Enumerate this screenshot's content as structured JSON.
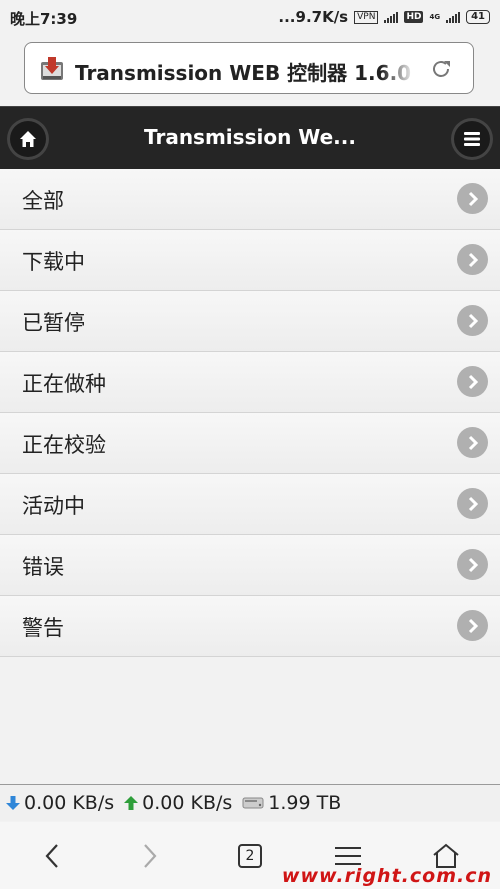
{
  "status_bar": {
    "time": "晚上7:39",
    "speed": "...9.7K/s",
    "vpn": "VPN",
    "hd": "HD",
    "net": "4G",
    "battery": "41"
  },
  "url_bar": {
    "title": "Transmission WEB 控制器 1.6.0",
    "favicon": "transmission-logo-icon",
    "reload_icon": "reload-icon"
  },
  "header": {
    "title": "Transmission We...",
    "home_icon": "home-icon",
    "menu_icon": "menu-icon"
  },
  "filters": [
    {
      "label": "全部"
    },
    {
      "label": "下载中"
    },
    {
      "label": "已暂停"
    },
    {
      "label": "正在做种"
    },
    {
      "label": "正在校验"
    },
    {
      "label": "活动中"
    },
    {
      "label": "错误"
    },
    {
      "label": "警告"
    }
  ],
  "footer": {
    "download_speed": "0.00 KB/s",
    "upload_speed": "0.00 KB/s",
    "free_space": "1.99 TB"
  },
  "navbar": {
    "tab_count": "2"
  },
  "watermark": "www.right.com.cn",
  "colors": {
    "header_bg": "#252525",
    "arrow_bg": "#b0b0b0",
    "download_arrow": "#2f86d8",
    "upload_arrow": "#2e9e3a",
    "watermark": "#d01515"
  }
}
